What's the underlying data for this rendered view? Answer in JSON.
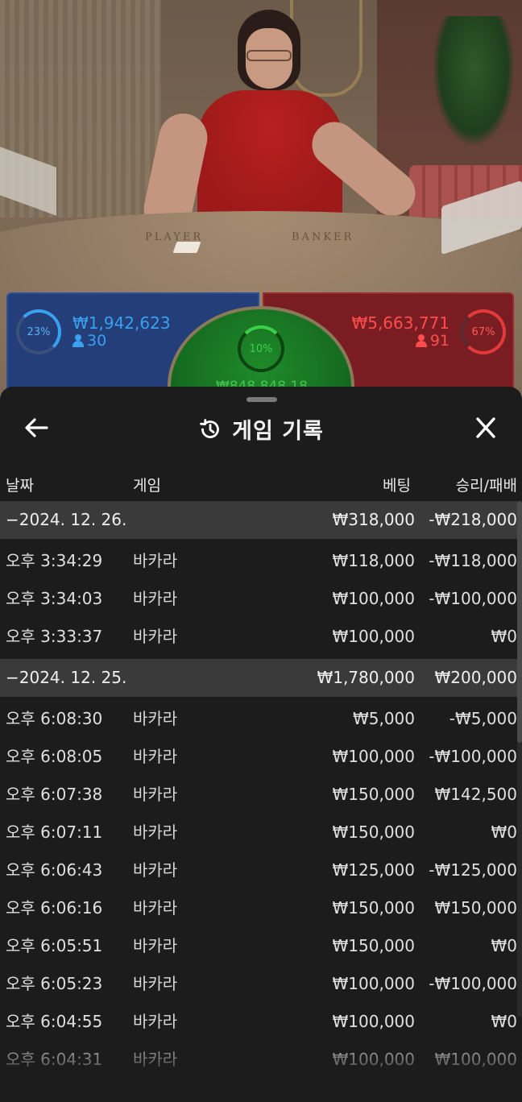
{
  "video": {
    "player_label": "PLAYER",
    "banker_label": "BANKER"
  },
  "betting": {
    "player": {
      "percent": "23%",
      "amount": "₩1,942,623",
      "count": "30",
      "color": "#3aa0f0"
    },
    "banker": {
      "percent": "67%",
      "amount": "₩5,663,771",
      "count": "91",
      "color": "#ff4c4c"
    },
    "tie": {
      "percent": "10%",
      "amount": "₩848,848.18",
      "color": "#39d24c"
    }
  },
  "history": {
    "title": "게임 기록",
    "icons": {
      "back": "arrow-left-icon",
      "history": "history-clock-icon",
      "close": "close-icon"
    },
    "columns": {
      "date": "날짜",
      "game": "게임",
      "bet": "베팅",
      "win_loss": "승리/패배"
    },
    "groups": [
      {
        "date": "−2024. 12. 26.",
        "bet": "₩318,000",
        "win_loss": "-₩218,000",
        "rows": [
          {
            "time": "오후 3:34:29",
            "game": "바카라",
            "bet": "₩118,000",
            "win_loss": "-₩118,000"
          },
          {
            "time": "오후 3:34:03",
            "game": "바카라",
            "bet": "₩100,000",
            "win_loss": "-₩100,000"
          },
          {
            "time": "오후 3:33:37",
            "game": "바카라",
            "bet": "₩100,000",
            "win_loss": "₩0"
          }
        ]
      },
      {
        "date": "−2024. 12. 25.",
        "bet": "₩1,780,000",
        "win_loss": "₩200,000",
        "rows": [
          {
            "time": "오후 6:08:30",
            "game": "바카라",
            "bet": "₩5,000",
            "win_loss": "-₩5,000"
          },
          {
            "time": "오후 6:08:05",
            "game": "바카라",
            "bet": "₩100,000",
            "win_loss": "-₩100,000"
          },
          {
            "time": "오후 6:07:38",
            "game": "바카라",
            "bet": "₩150,000",
            "win_loss": "₩142,500"
          },
          {
            "time": "오후 6:07:11",
            "game": "바카라",
            "bet": "₩150,000",
            "win_loss": "₩0"
          },
          {
            "time": "오후 6:06:43",
            "game": "바카라",
            "bet": "₩125,000",
            "win_loss": "-₩125,000"
          },
          {
            "time": "오후 6:06:16",
            "game": "바카라",
            "bet": "₩150,000",
            "win_loss": "₩150,000"
          },
          {
            "time": "오후 6:05:51",
            "game": "바카라",
            "bet": "₩150,000",
            "win_loss": "₩0"
          },
          {
            "time": "오후 6:05:23",
            "game": "바카라",
            "bet": "₩100,000",
            "win_loss": "-₩100,000"
          },
          {
            "time": "오후 6:04:55",
            "game": "바카라",
            "bet": "₩100,000",
            "win_loss": "₩0"
          },
          {
            "time": "오후 6:04:31",
            "game": "바카라",
            "bet": "₩100,000",
            "win_loss": "₩100,000"
          }
        ]
      }
    ]
  }
}
